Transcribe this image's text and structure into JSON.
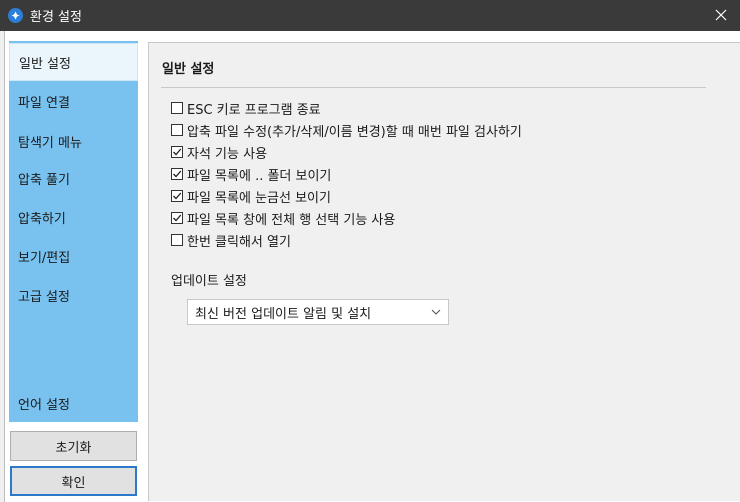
{
  "window": {
    "title": "환경 설정"
  },
  "sidebar": {
    "items": [
      {
        "label": "일반 설정",
        "active": true
      },
      {
        "label": "파일 연결"
      },
      {
        "label": "탐색기 메뉴"
      },
      {
        "label": "압축 풀기"
      },
      {
        "label": "압축하기"
      },
      {
        "label": "보기/편집"
      },
      {
        "label": "고급 설정"
      },
      {
        "label": "언어 설정"
      }
    ]
  },
  "buttons": {
    "reset": "초기화",
    "ok": "확인"
  },
  "main": {
    "title": "일반 설정",
    "options": [
      {
        "label": "ESC 키로 프로그램 종료",
        "checked": false
      },
      {
        "label": "압축 파일 수정(추가/삭제/이름 변경)할 때 매번 파일 검사하기",
        "checked": false
      },
      {
        "label": "자석 기능 사용",
        "checked": true
      },
      {
        "label": "파일 목록에 .. 폴더 보이기",
        "checked": true
      },
      {
        "label": "파일 목록에 눈금선 보이기",
        "checked": true
      },
      {
        "label": "파일 목록 창에 전체 행 선택 기능 사용",
        "checked": true
      },
      {
        "label": "한번 클릭해서 열기",
        "checked": false
      }
    ],
    "update": {
      "label": "업데이트 설정",
      "selected": "최신 버전 업데이트 알림 및 설치"
    }
  },
  "colors": {
    "sidebar": "#79c1ee",
    "titlebar": "#3a3a3a",
    "accent": "#2e78c9"
  },
  "icons": {
    "app": "app-logo-icon",
    "close": "close-icon",
    "dropdown": "chevron-down-icon",
    "check": "checkmark-icon"
  }
}
